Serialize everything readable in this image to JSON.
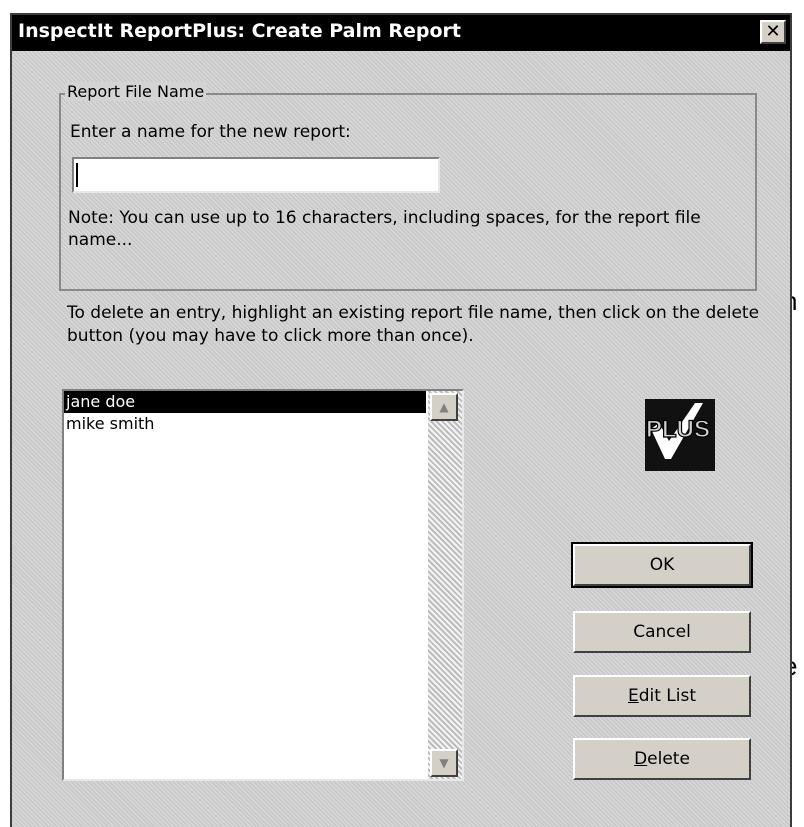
{
  "background": {
    "left_glyph_1": "n",
    "left_glyph_2": "e"
  },
  "window": {
    "title": "InspectIt ReportPlus: Create Palm Report",
    "close_glyph": "✕"
  },
  "report_file_name_group": {
    "legend": "Report File Name",
    "prompt": "Enter a name for the new report:",
    "name_value": "",
    "note": "Note: You can use up to 16 characters, including spaces, for the report file name..."
  },
  "instructions": "To delete an entry, highlight an existing report file name, then click on the delete button (you may have to click more than once).",
  "report_list": {
    "items": [
      {
        "label": "jane doe",
        "selected": true
      },
      {
        "label": "mike smith",
        "selected": false
      }
    ],
    "scroll_up_glyph": "▲",
    "scroll_down_glyph": "▼"
  },
  "logo": {
    "text": "PLUS",
    "icon": "plus-checkmark-logo"
  },
  "buttons": {
    "ok": "OK",
    "cancel": "Cancel",
    "edit_list_mnemonic": "E",
    "edit_list_rest": "dit List",
    "delete_mnemonic": "D",
    "delete_rest": "elete"
  },
  "colors": {
    "titlebar_bg": "#000000",
    "dialog_bg": "#d4d4d4",
    "selection_bg": "#000000"
  }
}
